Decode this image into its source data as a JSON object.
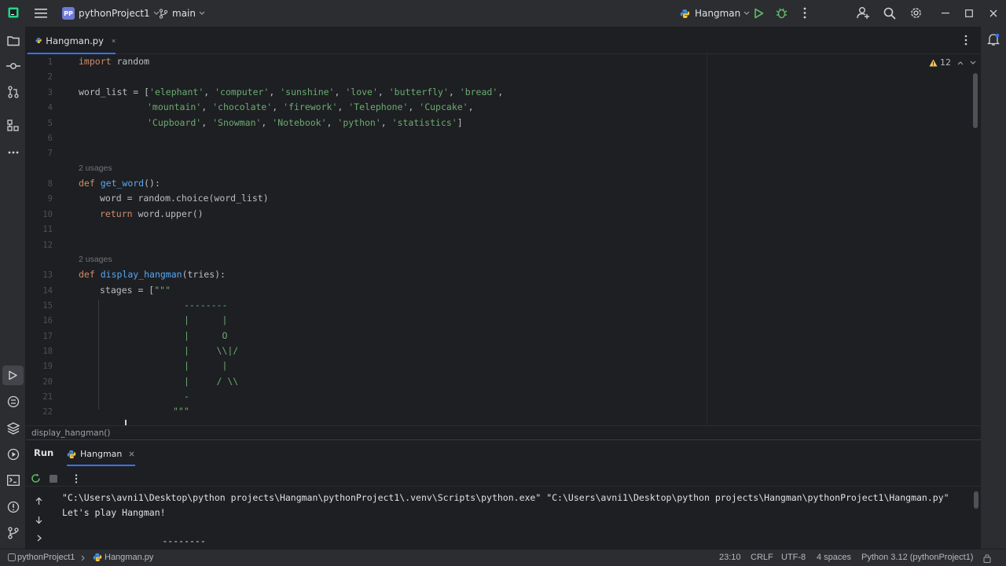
{
  "titlebar": {
    "project_badge": "PP",
    "project_name": "pythonProject1",
    "branch": "main",
    "run_config": "Hangman"
  },
  "editor_tabs": [
    {
      "label": "Hangman.py"
    }
  ],
  "editor": {
    "warning_count": "12",
    "lines": [
      "1",
      "2",
      "3",
      "4",
      "5",
      "6",
      "7",
      "8",
      "9",
      "10",
      "11",
      "12",
      "13",
      "14",
      "15",
      "16",
      "17",
      "18",
      "19",
      "20",
      "21",
      "22"
    ],
    "code": {
      "l1_kw": "import",
      "l1_rest": " random",
      "l3_a": "word_list = [",
      "l3_s": "'elephant'",
      "l3_s2": ", ",
      "l3_s3": "'computer'",
      "l3_s4": "'sunshine'",
      "l3_s5": "'love'",
      "l3_s6": "'butterfly'",
      "l3_s7": "'bread'",
      "l4_s1": "'mountain'",
      "l4_s2": "'chocolate'",
      "l4_s3": "'firework'",
      "l4_s4": "'Telephone'",
      "l4_s5": "'Cupcake'",
      "l5_s1": "'Cupboard'",
      "l5_s2": "'Snowman'",
      "l5_s3": "'Notebook'",
      "l5_s4": "'python'",
      "l5_s5": "'statistics'",
      "usages": "2 usages",
      "def": "def",
      "fn_get_word": "get_word",
      "get_word_sig": "():",
      "l9": "word = random.choice(word_list)",
      "return": "return",
      "l10_rest": " word.upper()",
      "fn_display": "display_hangman",
      "display_sig": "(tries):",
      "l14_a": "stages = [",
      "l14_s": "\"\"\"",
      "art15": "--------",
      "art16": "|      |",
      "art17": "|      O",
      "art18": "|     \\\\|/",
      "art19": "|      |",
      "art20": "|     / \\\\",
      "art21": "-",
      "art22": "\"\"\""
    }
  },
  "breadcrumb": "display_hangman()",
  "run_panel": {
    "tab_run": "Run",
    "tab_config": "Hangman",
    "output": [
      "\"C:\\Users\\avni1\\Desktop\\python projects\\Hangman\\pythonProject1\\.venv\\Scripts\\python.exe\" \"C:\\Users\\avni1\\Desktop\\python projects\\Hangman\\pythonProject1\\Hangman.py\"",
      "Let's play Hangman!",
      "",
      "        --------"
    ]
  },
  "statusbar": {
    "project": "pythonProject1",
    "file": "Hangman.py",
    "position": "23:10",
    "line_sep": "CRLF",
    "encoding": "UTF-8",
    "indent": "4 spaces",
    "interpreter": "Python 3.12 (pythonProject1)"
  },
  "colors": {
    "background": "#1e1f22",
    "panel": "#2b2d30",
    "keyword": "#cf8e6d",
    "string": "#6aab73",
    "function": "#56a8f5",
    "accent": "#3574f0",
    "run_green": "#5fb865"
  }
}
